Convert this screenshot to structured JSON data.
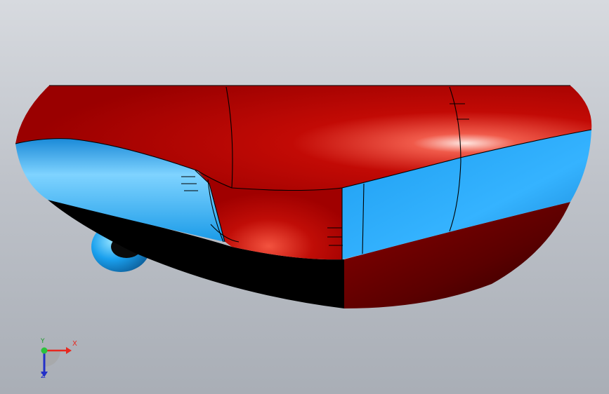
{
  "viewport": {
    "background_top": "#d7dadf",
    "background_bottom": "#a9aeb6"
  },
  "model": {
    "colors": {
      "red": "#b30000",
      "red_dark": "#5a0000",
      "blue": "#1aa0ee",
      "blue_light": "#7fd3ff",
      "black": "#000000"
    }
  },
  "triad": {
    "x_label": "X",
    "y_label": "Y",
    "z_label": "Z",
    "colors": {
      "x": "#e8281f",
      "y": "#1a9a2a",
      "z": "#2330c8"
    }
  }
}
